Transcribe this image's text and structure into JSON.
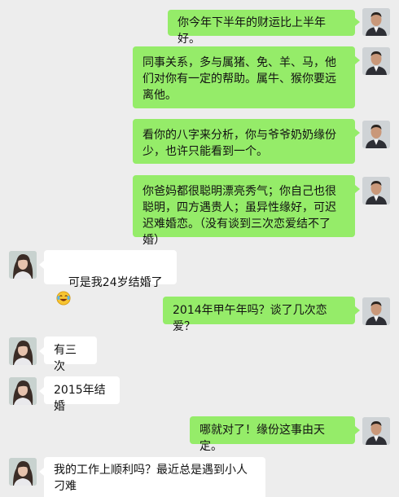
{
  "chat": {
    "messages": [
      {
        "side": "out",
        "text": "你今年下半年的财运比上半年好。"
      },
      {
        "side": "out",
        "text": "同事关系，多与属猪、免、羊、马，他们对你有一定的帮助。属牛、猴你要远离他。"
      },
      {
        "side": "out",
        "text": "看你的八字来分析，你与爷爷奶奶缘份少，也许只能看到一个。"
      },
      {
        "side": "out",
        "text": "你爸妈都很聪明漂亮秀气；你自己也很聪明，四方遇贵人；虽异性缘好，可迟迟难婚恋。（没有谈到三次恋爱结不了婚）"
      },
      {
        "side": "in",
        "text": "可是我24岁结婚了",
        "emoji": "laughing-tears-emoji"
      },
      {
        "side": "out",
        "text": "2014年甲午年吗？谈了几次恋爱？"
      },
      {
        "side": "in",
        "text": "有三次"
      },
      {
        "side": "in",
        "text": "2015年结婚"
      },
      {
        "side": "out",
        "text": "哪就对了！缘份这事由天定。"
      },
      {
        "side": "in",
        "text": "我的工作上顺利吗？最近总是遇到小人刁难"
      }
    ]
  },
  "colors": {
    "background": "#ededed",
    "outgoing_bubble": "#95ec69",
    "incoming_bubble": "#ffffff"
  },
  "icons": {
    "outgoing_avatar": "man-avatar-icon",
    "incoming_avatar": "woman-avatar-icon"
  }
}
